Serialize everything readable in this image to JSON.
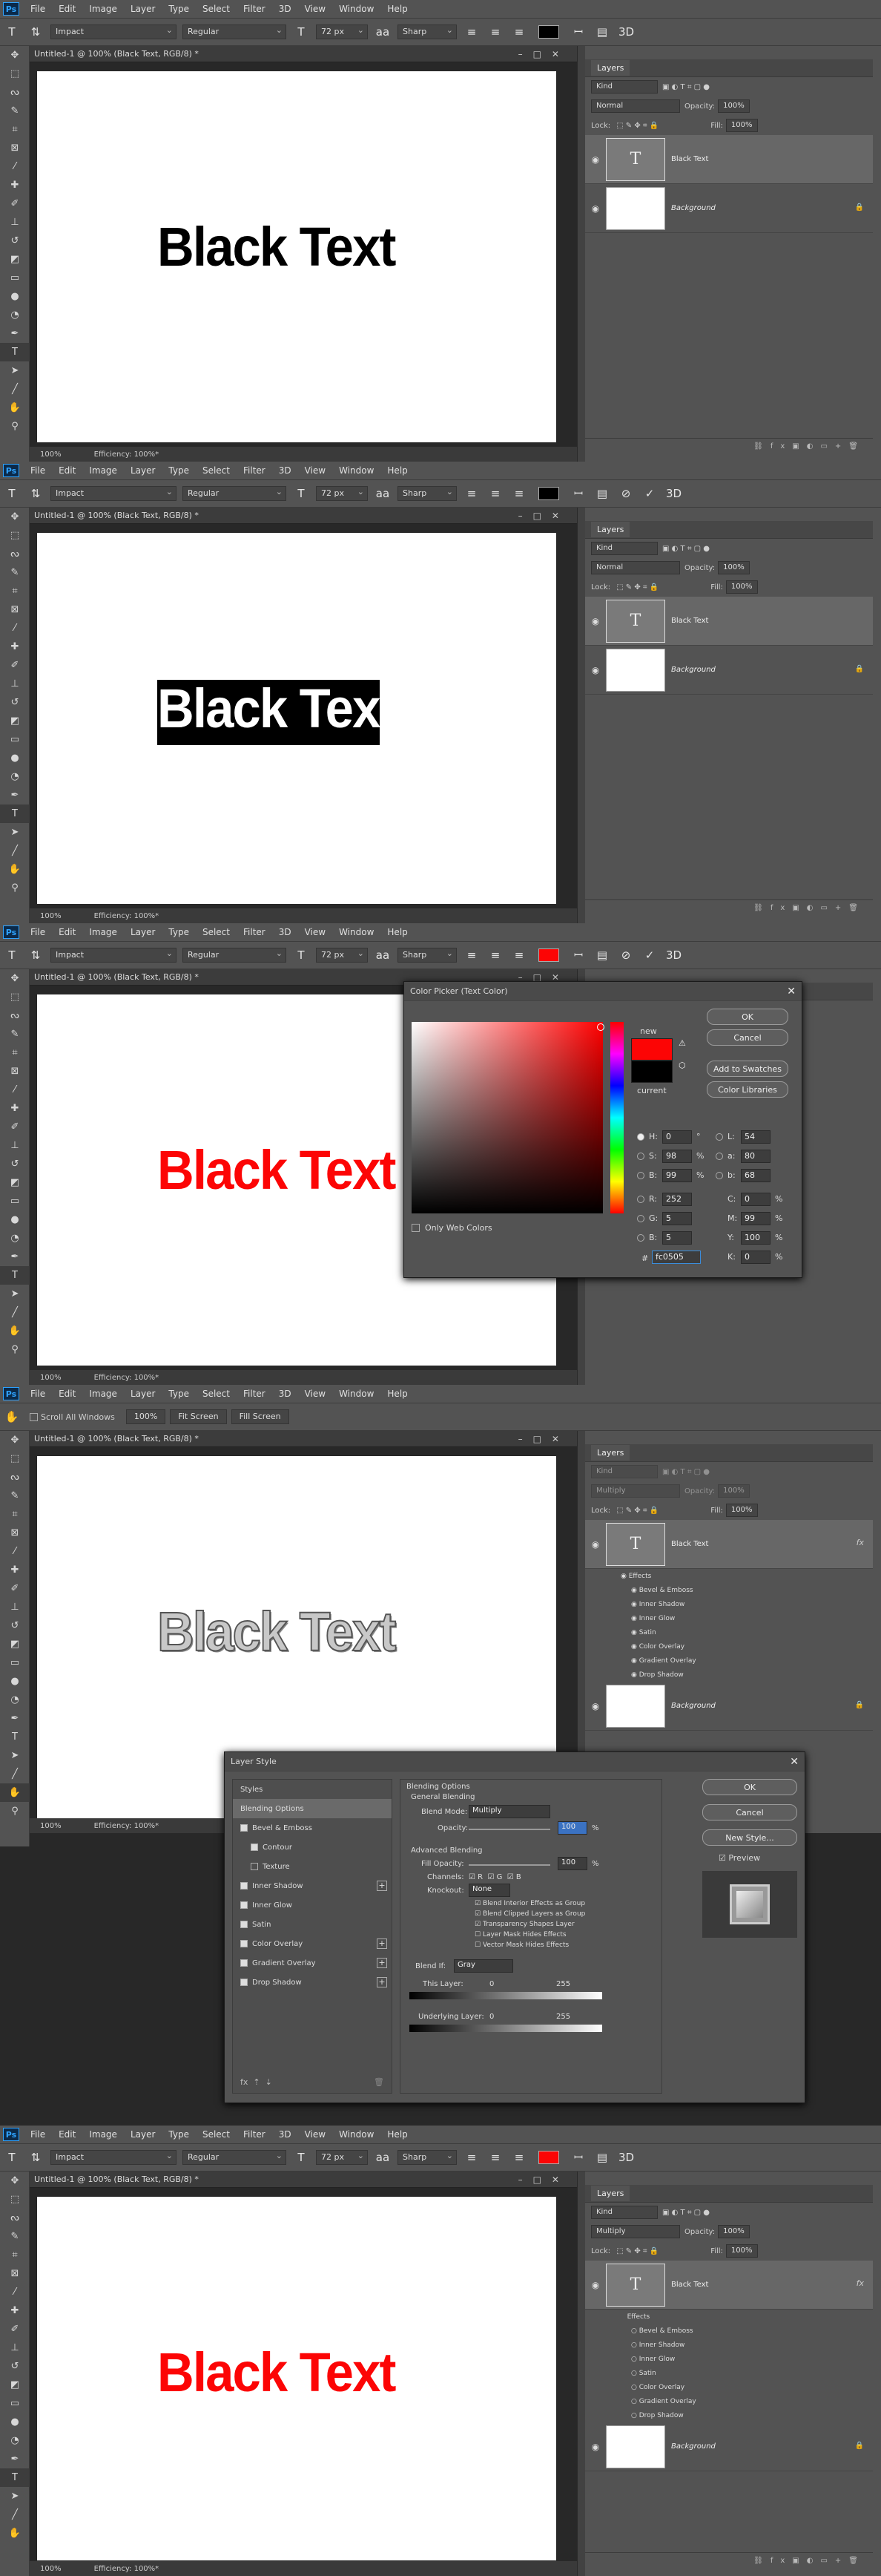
{
  "menu": [
    "File",
    "Edit",
    "Image",
    "Layer",
    "Type",
    "Select",
    "Filter",
    "3D",
    "View",
    "Window",
    "Help"
  ],
  "app_logo": "Ps",
  "options": {
    "font_family": "Impact",
    "font_style": "Regular",
    "font_size": "72 px",
    "aa_label": "aa",
    "aa_mode": "Sharp",
    "warp_label": "3D"
  },
  "hand_options": {
    "scroll_all": "Scroll All Windows",
    "zoom": "100%",
    "fit": "Fit Screen",
    "fill": "Fill Screen"
  },
  "document": {
    "tab_title": "Untitled-1 @ 100% (Black Text, RGB/8) *",
    "text": "Black Text",
    "zoom": "100%",
    "efficiency": "Efficiency: 100%*"
  },
  "colors": {
    "black": "#000000",
    "red": "#fc0505"
  },
  "layers": {
    "tab": "Layers",
    "kind": "Kind",
    "blend": "Normal",
    "blend_multiply": "Multiply",
    "opacity_label": "Opacity:",
    "opacity": "100%",
    "lock_label": "Lock:",
    "fill_label": "Fill:",
    "fill": "100%",
    "text_layer": "Black Text",
    "bg_layer": "Background",
    "fx": "fx",
    "effects_label": "Effects",
    "effects": [
      "Bevel & Emboss",
      "Inner Shadow",
      "Inner Glow",
      "Satin",
      "Color Overlay",
      "Gradient Overlay",
      "Drop Shadow"
    ]
  },
  "color_picker": {
    "title": "Color Picker (Text Color)",
    "ok": "OK",
    "cancel": "Cancel",
    "add_swatches": "Add to Swatches",
    "libraries": "Color Libraries",
    "new": "new",
    "current": "current",
    "web_only": "Only Web Colors",
    "H": "0",
    "S": "98",
    "Bv": "99",
    "R": "252",
    "G": "5",
    "Bl": "5",
    "L": "54",
    "a": "80",
    "b": "68",
    "C": "0",
    "M": "99",
    "Y": "100",
    "K": "0",
    "hex": "fc0505"
  },
  "layer_style": {
    "title": "Layer Style",
    "styles_header": "Styles",
    "blending_options": "Blending Options",
    "items": [
      "Bevel & Emboss",
      "Contour",
      "Texture",
      "Inner Shadow",
      "Inner Glow",
      "Satin",
      "Color Overlay",
      "Gradient Overlay",
      "Drop Shadow"
    ],
    "general": "General Blending",
    "blend_mode_label": "Blend Mode:",
    "blend_mode": "Multiply",
    "opacity_label": "Opacity:",
    "opacity": "100",
    "advanced": "Advanced Blending",
    "fill_opacity_label": "Fill Opacity:",
    "fill_opacity": "100",
    "channels_label": "Channels:",
    "knockout_label": "Knockout:",
    "knockout": "None",
    "adv_opts": [
      "Blend Interior Effects as Group",
      "Blend Clipped Layers as Group",
      "Transparency Shapes Layer",
      "Layer Mask Hides Effects",
      "Vector Mask Hides Effects"
    ],
    "blend_if_label": "Blend If:",
    "blend_if": "Gray",
    "this_layer": "This Layer:",
    "underlying": "Underlying Layer:",
    "zero": "0",
    "max": "255",
    "ok": "OK",
    "cancel": "Cancel",
    "new_style": "New Style...",
    "preview": "Preview",
    "pct": "%"
  }
}
